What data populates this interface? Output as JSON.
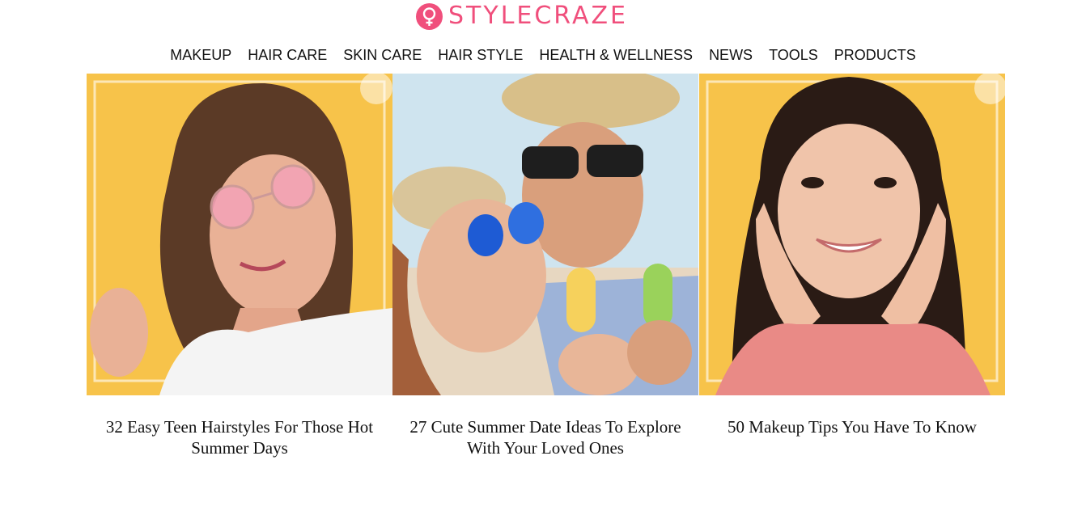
{
  "brand": {
    "name": "STYLECRAZE",
    "logo_icon": "female-symbol-icon",
    "color": "#f04f7c"
  },
  "nav": {
    "items": [
      {
        "label": "MAKEUP"
      },
      {
        "label": "HAIR CARE"
      },
      {
        "label": "SKIN CARE"
      },
      {
        "label": "HAIR STYLE"
      },
      {
        "label": "HEALTH & WELLNESS"
      },
      {
        "label": "NEWS"
      },
      {
        "label": "TOOLS"
      },
      {
        "label": "PRODUCTS"
      }
    ]
  },
  "articles": [
    {
      "title": "32 Easy Teen Hairstyles For Those Hot Summer Days",
      "image": "teen-hairstyle-photo"
    },
    {
      "title": "27 Cute Summer Date Ideas To Explore With Your Loved Ones",
      "image": "summer-date-couple-photo"
    },
    {
      "title": "50 Makeup Tips You Have To Know",
      "image": "makeup-tips-photo"
    }
  ],
  "colors": {
    "background_yellow": "#f7c34a",
    "text": "#111111"
  }
}
